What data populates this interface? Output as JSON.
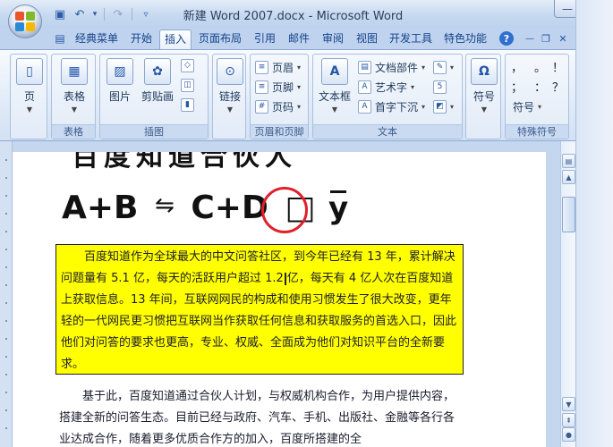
{
  "window": {
    "title": "新建 Word 2007.docx - Microsoft Word",
    "buttons": {
      "minimize": "—",
      "maximize": "□",
      "close": "✕"
    }
  },
  "quick_access": {
    "save_icon": "save-icon",
    "undo_icon": "undo-icon",
    "redo_icon": "redo-icon",
    "customize_icon": "chevron-down-icon",
    "undo_arrow": "▾"
  },
  "tabs": [
    {
      "label": "经典菜单"
    },
    {
      "label": "开始"
    },
    {
      "label": "插入",
      "active": true
    },
    {
      "label": "页面布局"
    },
    {
      "label": "引用"
    },
    {
      "label": "邮件"
    },
    {
      "label": "审阅"
    },
    {
      "label": "视图"
    },
    {
      "label": "开发工具"
    },
    {
      "label": "特色功能"
    }
  ],
  "ribbon_controls": {
    "help": "?",
    "minimize": "—",
    "restore": "❐",
    "close": "✕"
  },
  "ribbon": {
    "page_group": {
      "button": "页"
    },
    "table_group": {
      "label": "表格",
      "button": "表格"
    },
    "illustrations": {
      "label": "插图",
      "picture": "图片",
      "clipart": "剪贴画"
    },
    "links": {
      "button": "链接"
    },
    "header_footer": {
      "label": "页眉和页脚",
      "header": "页眉",
      "footer": "页脚",
      "page_number": "页码"
    },
    "text": {
      "label": "文本",
      "textbox": "文本框",
      "quickparts": "文档部件",
      "wordart": "艺术字",
      "dropcap": "首字下沉"
    },
    "symbols": {
      "button": "符号"
    },
    "special": {
      "label": "特殊符号",
      "sym1": "，",
      "sym2": "。",
      "sym3": "；",
      "sym4": "：",
      "sym5": "！",
      "sym6": "？",
      "more": "符号"
    }
  },
  "document": {
    "heading_partial": "百度知道合伙人",
    "equation": {
      "left": "A+B",
      "arrow": "⇋",
      "right": "C+D",
      "box": "□",
      "ybar": "y"
    },
    "paragraph1_a": "百度知道作为全球最大的中文问答社区，到今年已经有 13 年，累计解决问题量有 5.1 亿，每天的活跃用户超过 1.2",
    "paragraph1_b": "亿，每天有 4 亿人次在百度知道上获取信息。13 年间，互联网网民的构成和使用习惯发生了很大改变，更年轻的一代网民更习惯把互联网当作获取任何信息和获取服务的首选入口，因此他们对问答的要求也更高，专业、权威、全面成为他们对知识平台的全新要求。",
    "paragraph2": "基于此，百度知道通过合伙人计划，与权威机构合作，为用户提供内容，搭建全新的问答生态。目前已经与政府、汽车、手机、出版社、金融等各行各业达成合作，随着更多优质合作方的加入，百度所搭建的全"
  }
}
